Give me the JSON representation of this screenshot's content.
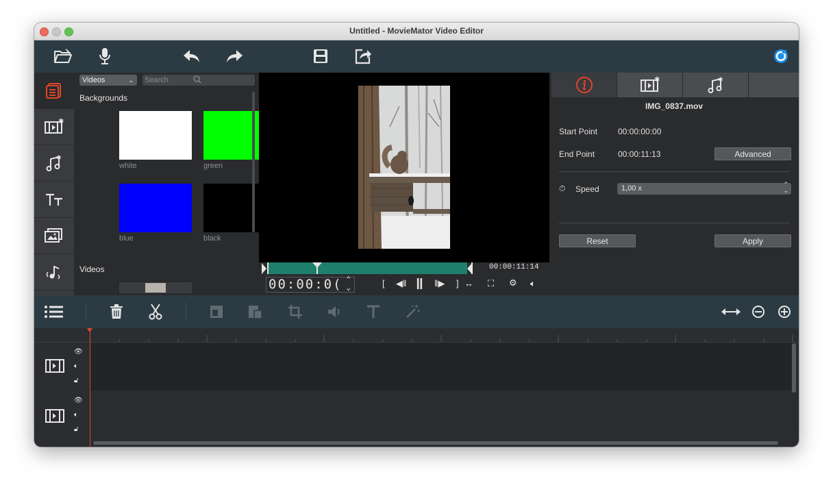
{
  "window": {
    "title": "Untitled - MovieMator Video Editor"
  },
  "toolbar": {
    "buttons": [
      "open-folder-icon",
      "microphone-icon",
      "undo-icon",
      "redo-icon",
      "save-icon",
      "export-icon",
      "app-badge-icon"
    ]
  },
  "left_tabs": [
    "file-library-icon",
    "video-filter-icon",
    "audio-filter-icon",
    "text-icon",
    "image-sticker-icon",
    "audio-effect-icon"
  ],
  "library": {
    "dropdown_value": "Videos",
    "search_placeholder": "Search",
    "section_backgrounds": "Backgrounds",
    "swatches": [
      {
        "label": "white",
        "color": "#ffffff"
      },
      {
        "label": "green",
        "color": "#00ff00"
      },
      {
        "label": "blue",
        "color": "#0000ff"
      },
      {
        "label": "black",
        "color": "#000000"
      }
    ],
    "section_videos": "Videos"
  },
  "player": {
    "duration": "00:00:11:14",
    "timecode": "00:00:0(",
    "progress": 0.0
  },
  "properties": {
    "filename": "IMG_0837.mov",
    "start_label": "Start Point",
    "start_value": "00:00:00:00",
    "end_label": "End Point",
    "end_value": "00:00:11:13",
    "advanced_button": "Advanced",
    "speed_label": "Speed",
    "speed_value": "1,00 x",
    "reset_button": "Reset",
    "apply_button": "Apply"
  },
  "timeline": {
    "tracks": [
      "video-track-1",
      "video-track-2"
    ]
  },
  "colors": {
    "accent_orange": "#e0452a",
    "teal": "#1f7f6d",
    "toolbar_bg": "#2c3b43"
  }
}
